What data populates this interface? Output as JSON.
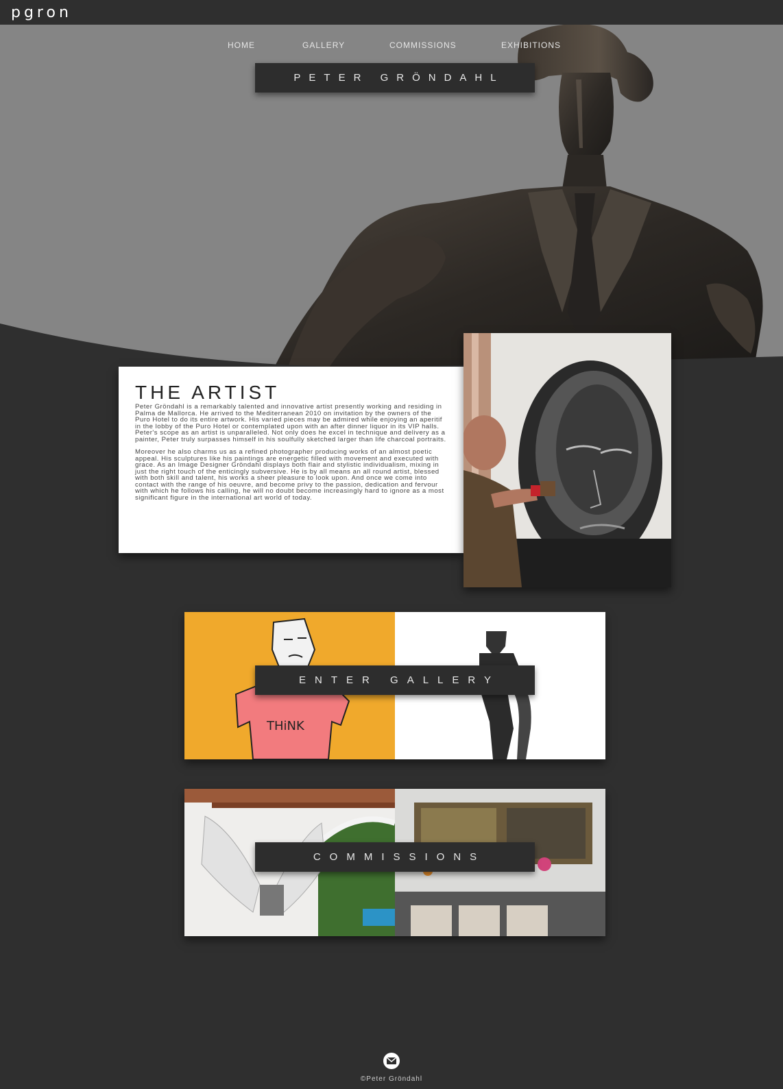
{
  "site": {
    "logo": "pgron"
  },
  "nav": {
    "items": [
      {
        "label": "HOME"
      },
      {
        "label": "GALLERY"
      },
      {
        "label": "COMMISSIONS"
      },
      {
        "label": "EXHIBITIONS"
      }
    ]
  },
  "hero": {
    "title": "PETER GRÖNDAHL"
  },
  "artist": {
    "heading": "THE ARTIST",
    "paragraph1": "Peter Gröndahl is a remarkably talented and innovative artist presently working and residing in Palma de Mallorca. He arrived to the Mediterranean 2010 on invitation by the owners of the Puro Hotel to do its entire artwork. His varied pieces may be admired while enjoying an aperitif in the lobby of the Puro Hotel or contemplated upon with an after dinner liquor in its VIP halls. Peter's scope as an artist is unparalleled. Not only does he excel in technique and delivery as a painter, Peter truly surpasses himself in his soulfully sketched larger than life charcoal portraits.",
    "paragraph2": "Moreover he also charms us as a refined photographer producing works of an almost poetic appeal. His sculptures like his paintings are energetic filled with movement and executed with grace. As an Image Designer Gröndahl displays both flair and stylistic individualism, mixing in just the right touch of the enticingly subversive. He is by all means an all round artist, blessed with both skill and talent, his works a sheer pleasure to look upon. And once we come into contact with the range of his oeuvre, and become privy to the passion, dedication and fervour with which he follows his calling, he will no doubt become increasingly hard to ignore as a most significant figure in the international art world of today."
  },
  "gallery_panel": {
    "label": "ENTER GALLERY",
    "tshirt_text": "THiNK"
  },
  "commissions_panel": {
    "label": "COMMISSIONS"
  },
  "footer": {
    "copyright": "©Peter Gröndahl",
    "mail_icon": "envelope-icon"
  }
}
